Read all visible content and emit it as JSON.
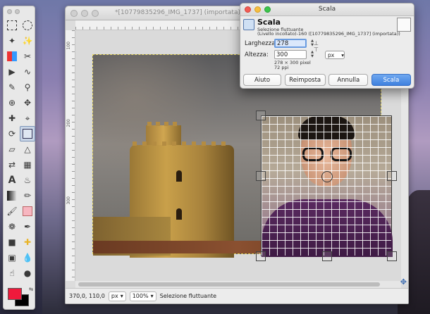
{
  "image_window": {
    "title": "*[10779835296_IMG_1737] (importata)-6,",
    "status": {
      "coords": "370,0, 110,0",
      "unit": "px",
      "zoom": "100%",
      "message": "Selezione fluttuante"
    },
    "ruler_left_labels": [
      "100",
      "200",
      "300"
    ]
  },
  "dialog": {
    "title": "Scala",
    "heading": "Scala",
    "subtitle": "Selezione fluttuante",
    "subtitle2": "(Livello incollato)-160 ([10779835296_IMG_1737] (importata))",
    "width_label": "Larghezza:",
    "width_value": "278",
    "height_label": "Altezza:",
    "height_value": "300",
    "unit": "px",
    "size_info": "278 × 300 pixel",
    "resolution": "72 ppi",
    "buttons": {
      "help": "Aiuto",
      "reset": "Reimposta",
      "cancel": "Annulla",
      "scale": "Scala"
    }
  },
  "colors": {
    "foreground": "#ef1a3c",
    "background": "#000000",
    "primary_button": "#3f80de"
  }
}
